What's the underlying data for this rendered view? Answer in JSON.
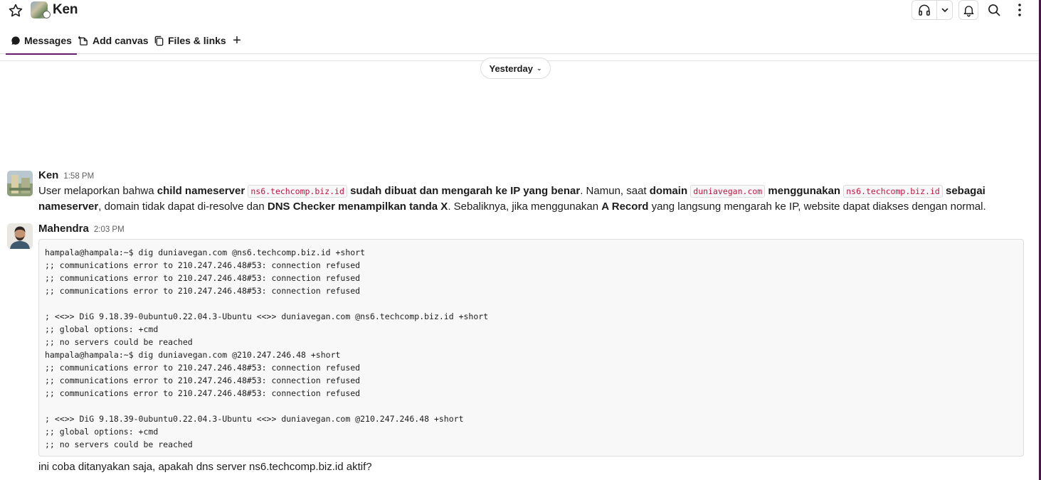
{
  "header": {
    "channel_title": "Ken",
    "icons": {
      "star": "star-icon",
      "huddle": "headphones-icon",
      "huddle_menu": "chevron-down-icon",
      "notifications": "bell-icon",
      "search": "search-icon",
      "more": "more-vertical-icon"
    }
  },
  "tabs": [
    {
      "label": "Messages",
      "icon": "message-bubble-icon",
      "active": true
    },
    {
      "label": "Add canvas",
      "icon": "canvas-icon",
      "active": false
    },
    {
      "label": "Files & links",
      "icon": "files-icon",
      "active": false
    },
    {
      "label": "+",
      "icon": "plus-icon",
      "active": false
    }
  ],
  "date_divider": {
    "label": "Yesterday"
  },
  "messages": [
    {
      "author": "Ken",
      "time": "1:58 PM",
      "segments": [
        {
          "t": "text",
          "v": "User melaporkan bahwa "
        },
        {
          "t": "bold",
          "v": "child nameserver"
        },
        {
          "t": "text",
          "v": " "
        },
        {
          "t": "code",
          "v": "ns6.techcomp.biz.id"
        },
        {
          "t": "text",
          "v": " "
        },
        {
          "t": "bold",
          "v": "sudah dibuat dan mengarah ke IP yang benar"
        },
        {
          "t": "text",
          "v": ". Namun, saat "
        },
        {
          "t": "bold",
          "v": "domain"
        },
        {
          "t": "text",
          "v": " "
        },
        {
          "t": "code",
          "v": "duniavegan.com"
        },
        {
          "t": "text",
          "v": " "
        },
        {
          "t": "bold",
          "v": "menggunakan"
        },
        {
          "t": "text",
          "v": " "
        },
        {
          "t": "code",
          "v": "ns6.techcomp.biz.id"
        },
        {
          "t": "text",
          "v": " "
        },
        {
          "t": "bold",
          "v": "sebagai nameserver"
        },
        {
          "t": "text",
          "v": ", domain tidak dapat di-resolve dan "
        },
        {
          "t": "bold",
          "v": "DNS Checker menampilkan tanda X"
        },
        {
          "t": "text",
          "v": ". Sebaliknya, jika menggunakan "
        },
        {
          "t": "bold",
          "v": "A Record"
        },
        {
          "t": "text",
          "v": " yang langsung mengarah ke IP, website dapat diakses dengan normal."
        }
      ]
    },
    {
      "author": "Mahendra",
      "time": "2:03 PM",
      "code_lines": [
        "hampala@hampala:~$ dig duniavegan.com @ns6.techcomp.biz.id +short",
        ";; communications error to 210.247.246.48#53: connection refused",
        ";; communications error to 210.247.246.48#53: connection refused",
        ";; communications error to 210.247.246.48#53: connection refused",
        "",
        "; <<>> DiG 9.18.39-0ubuntu0.22.04.3-Ubuntu <<>> duniavegan.com @ns6.techcomp.biz.id +short",
        ";; global options: +cmd",
        ";; no servers could be reached",
        "hampala@hampala:~$ dig duniavegan.com @210.247.246.48 +short",
        ";; communications error to 210.247.246.48#53: connection refused",
        ";; communications error to 210.247.246.48#53: connection refused",
        ";; communications error to 210.247.246.48#53: connection refused",
        "",
        "; <<>> DiG 9.18.39-0ubuntu0.22.04.3-Ubuntu <<>> duniavegan.com @210.247.246.48 +short",
        ";; global options: +cmd",
        ";; no servers could be reached"
      ],
      "text": "ini coba ditanyakan saja, apakah dns server ns6.techcomp.biz.id aktif?"
    }
  ]
}
